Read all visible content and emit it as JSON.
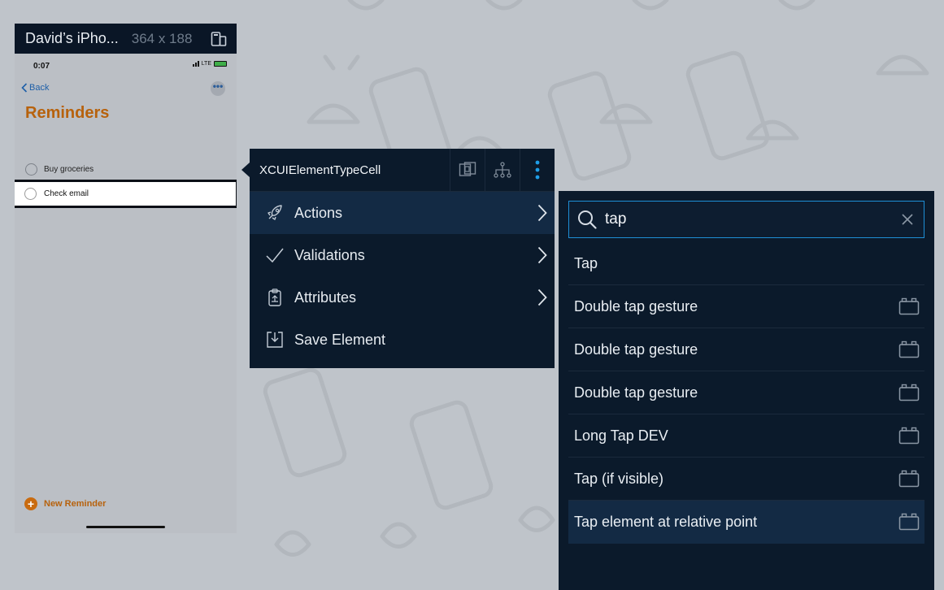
{
  "device": {
    "name": "David’s iPho...",
    "resolution": "364 x 188",
    "screen": {
      "time": "0:07",
      "network": "LTE",
      "back_label": "Back",
      "more_label": "•••",
      "title": "Reminders",
      "reminders": [
        "Buy groceries",
        "Check email"
      ],
      "new_reminder_label": "New Reminder",
      "accent_color": "#b7620d"
    }
  },
  "element_menu": {
    "element_type": "XCUIElementTypeCell",
    "items": [
      {
        "label": "Actions",
        "icon": "rocket-icon",
        "has_submenu": true,
        "active": true
      },
      {
        "label": "Validations",
        "icon": "checkmark-icon",
        "has_submenu": true,
        "active": false
      },
      {
        "label": "Attributes",
        "icon": "clipboard-icon",
        "has_submenu": true,
        "active": false
      },
      {
        "label": "Save Element",
        "icon": "save-icon",
        "has_submenu": false,
        "active": false
      }
    ]
  },
  "actions_panel": {
    "search": {
      "value": "tap",
      "placeholder": ""
    },
    "results": [
      {
        "label": "Tap",
        "has_block_icon": false
      },
      {
        "label": "Double tap gesture",
        "has_block_icon": true
      },
      {
        "label": "Double tap gesture",
        "has_block_icon": true
      },
      {
        "label": "Double tap gesture",
        "has_block_icon": true
      },
      {
        "label": "Long Tap DEV",
        "has_block_icon": true
      },
      {
        "label": "Tap (if visible)",
        "has_block_icon": true
      },
      {
        "label": "Tap element at relative point",
        "has_block_icon": true,
        "selected": true
      }
    ]
  },
  "colors": {
    "panel_bg": "#0b1a2b",
    "active_bg": "#132a44",
    "search_border": "#1e8fd6",
    "kebab_accent": "#1e9ee8"
  }
}
